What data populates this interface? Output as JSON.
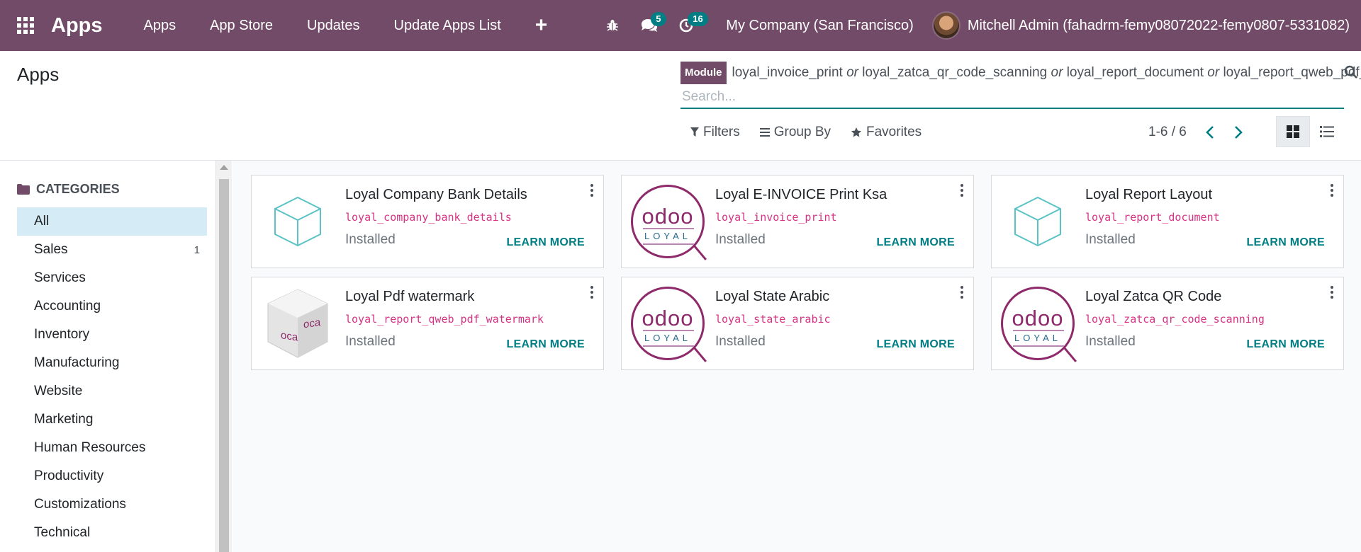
{
  "navbar": {
    "brand": "Apps",
    "menu": [
      "Apps",
      "App Store",
      "Updates",
      "Update Apps List"
    ],
    "plus": "+",
    "chat_badge": "5",
    "activity_badge": "16",
    "company": "My Company (San Francisco)",
    "user": "Mitchell Admin (fahadrm-femy08072022-femy0807-5331082)"
  },
  "control_panel": {
    "title": "Apps",
    "facet_label": "Module",
    "facet_values": [
      "loyal_invoice_print",
      "loyal_zatca_qr_code_scanning",
      "loyal_report_document",
      "loyal_report_qweb_pdf_watermark"
    ],
    "facet_separator": "or",
    "search_placeholder": "Search...",
    "filters_label": "Filters",
    "groupby_label": "Group By",
    "favorites_label": "Favorites",
    "pager_text": "1-6 / 6"
  },
  "sidebar": {
    "header": "CATEGORIES",
    "items": [
      {
        "label": "All",
        "count": ""
      },
      {
        "label": "Sales",
        "count": "1"
      },
      {
        "label": "Services",
        "count": ""
      },
      {
        "label": "Accounting",
        "count": ""
      },
      {
        "label": "Inventory",
        "count": ""
      },
      {
        "label": "Manufacturing",
        "count": ""
      },
      {
        "label": "Website",
        "count": ""
      },
      {
        "label": "Marketing",
        "count": ""
      },
      {
        "label": "Human Resources",
        "count": ""
      },
      {
        "label": "Productivity",
        "count": ""
      },
      {
        "label": "Customizations",
        "count": ""
      },
      {
        "label": "Technical",
        "count": ""
      }
    ],
    "active_index": 0
  },
  "modules": [
    {
      "name": "Loyal Company Bank Details",
      "technical": "loyal_company_bank_details",
      "state": "Installed",
      "action": "LEARN MORE",
      "icon": "cube-icon"
    },
    {
      "name": "Loyal E-INVOICE Print Ksa",
      "technical": "loyal_invoice_print",
      "state": "Installed",
      "action": "LEARN MORE",
      "icon": "odoo-loyal-logo"
    },
    {
      "name": "Loyal Report Layout",
      "technical": "loyal_report_document",
      "state": "Installed",
      "action": "LEARN MORE",
      "icon": "cube-icon"
    },
    {
      "name": "Loyal Pdf watermark",
      "technical": "loyal_report_qweb_pdf_watermark",
      "state": "Installed",
      "action": "LEARN MORE",
      "icon": "oca-cube-icon"
    },
    {
      "name": "Loyal State Arabic",
      "technical": "loyal_state_arabic",
      "state": "Installed",
      "action": "LEARN MORE",
      "icon": "odoo-loyal-logo"
    },
    {
      "name": "Loyal Zatca QR Code",
      "technical": "loyal_zatca_qr_code_scanning",
      "state": "Installed",
      "action": "LEARN MORE",
      "icon": "odoo-loyal-logo"
    }
  ],
  "logo_text": {
    "top": "odoo",
    "bottom": "LOYAL",
    "oca": "oca"
  },
  "colors": {
    "brand": "#714b67",
    "accent": "#017e84",
    "tech_name": "#d63384",
    "active_category": "#d5ebf5"
  }
}
